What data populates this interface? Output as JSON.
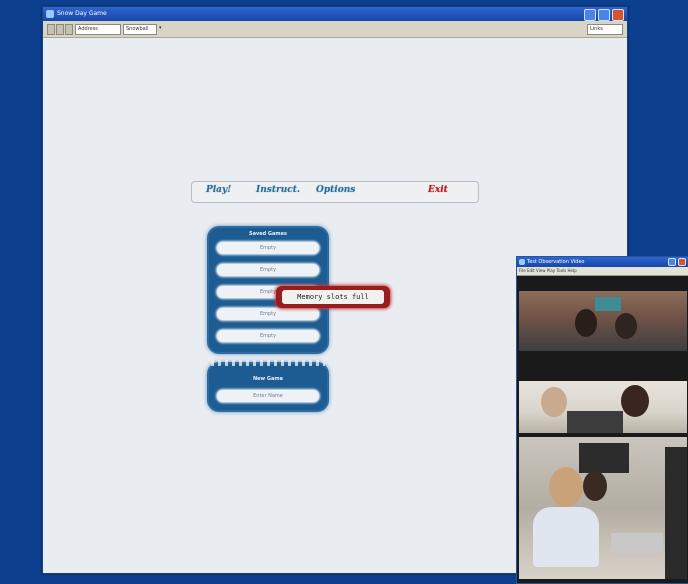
{
  "window": {
    "title": "Snow Day Game",
    "toolbar_box1": "Address",
    "toolbar_box2": "Snowball",
    "toolbar_right": "Links"
  },
  "game_nav": {
    "items": [
      {
        "label": "Play!",
        "color": "blue"
      },
      {
        "label": "Instruct.",
        "color": "blue"
      },
      {
        "label": "Options",
        "color": "blue"
      },
      {
        "label": "Exit",
        "color": "red"
      }
    ]
  },
  "saved_games": {
    "title": "Saved Games",
    "buttons": [
      "Empty",
      "Empty",
      "Empty",
      "Empty",
      "Empty"
    ]
  },
  "new_game": {
    "title": "New Game",
    "button": "Enter Name"
  },
  "tooltip": {
    "text": "Memory slots full"
  },
  "video_window": {
    "title": "Test Observation Video",
    "menu": "File  Edit  View  Play  Tools  Help"
  },
  "colors": {
    "desktop": "#0d3f8f",
    "frost_panel": "#1d5c92",
    "tooltip_border": "#9a1d1d"
  }
}
